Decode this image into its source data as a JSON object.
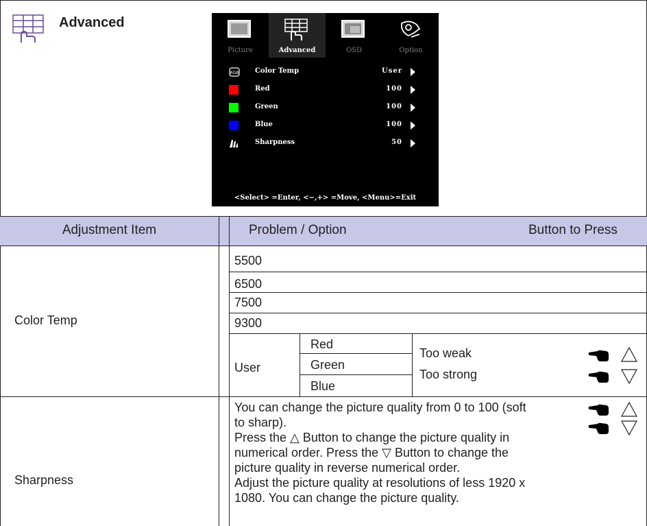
{
  "section": {
    "icon": "advanced-menu-icon",
    "title": "Advanced"
  },
  "osd": {
    "tabs": [
      {
        "label": "Picture",
        "icon": "picture-tab-icon",
        "active": false
      },
      {
        "label": "Advanced",
        "icon": "advanced-tab-icon",
        "active": true
      },
      {
        "label": "OSD",
        "icon": "osd-tab-icon",
        "active": false
      },
      {
        "label": "Option",
        "icon": "option-tab-icon",
        "active": false
      }
    ],
    "items": [
      {
        "name": "Color Temp",
        "value": "User",
        "icon": "rgb-icon"
      },
      {
        "name": "Red",
        "value": "100",
        "color": "#ff0000"
      },
      {
        "name": "Green",
        "value": "100",
        "color": "#00ff00"
      },
      {
        "name": "Blue",
        "value": "100",
        "color": "#0000ff"
      },
      {
        "name": "Sharpness",
        "value": "50",
        "icon": "sharpness-icon"
      }
    ],
    "hint": "<Select> =Enter, <−,+> =Move, <Menu>=Exit"
  },
  "table": {
    "header_bg": "#c7c8e8",
    "headers": {
      "item": "Adjustment Item",
      "problem": "Problem / Option",
      "button": "Button to Press"
    },
    "color_temp": {
      "label": "Color Temp",
      "options": [
        "5500",
        "6500",
        "7500",
        "9300"
      ],
      "user": {
        "label": "User",
        "channels": [
          "Red",
          "Green",
          "Blue"
        ],
        "too_weak": "Too weak",
        "too_strong": "Too strong"
      }
    },
    "sharpness": {
      "label": "Sharpness",
      "lines": [
        "You can change the picture quality from 0 to 100 (soft",
        "to sharp).",
        "Press the △ Button to change the picture quality in",
        "numerical order. Press the ▽ Button to change the",
        "picture quality in reverse numerical order.",
        "Adjust the picture quality at resolutions of less 1920 x",
        "1080. You can change the picture quality."
      ]
    }
  }
}
